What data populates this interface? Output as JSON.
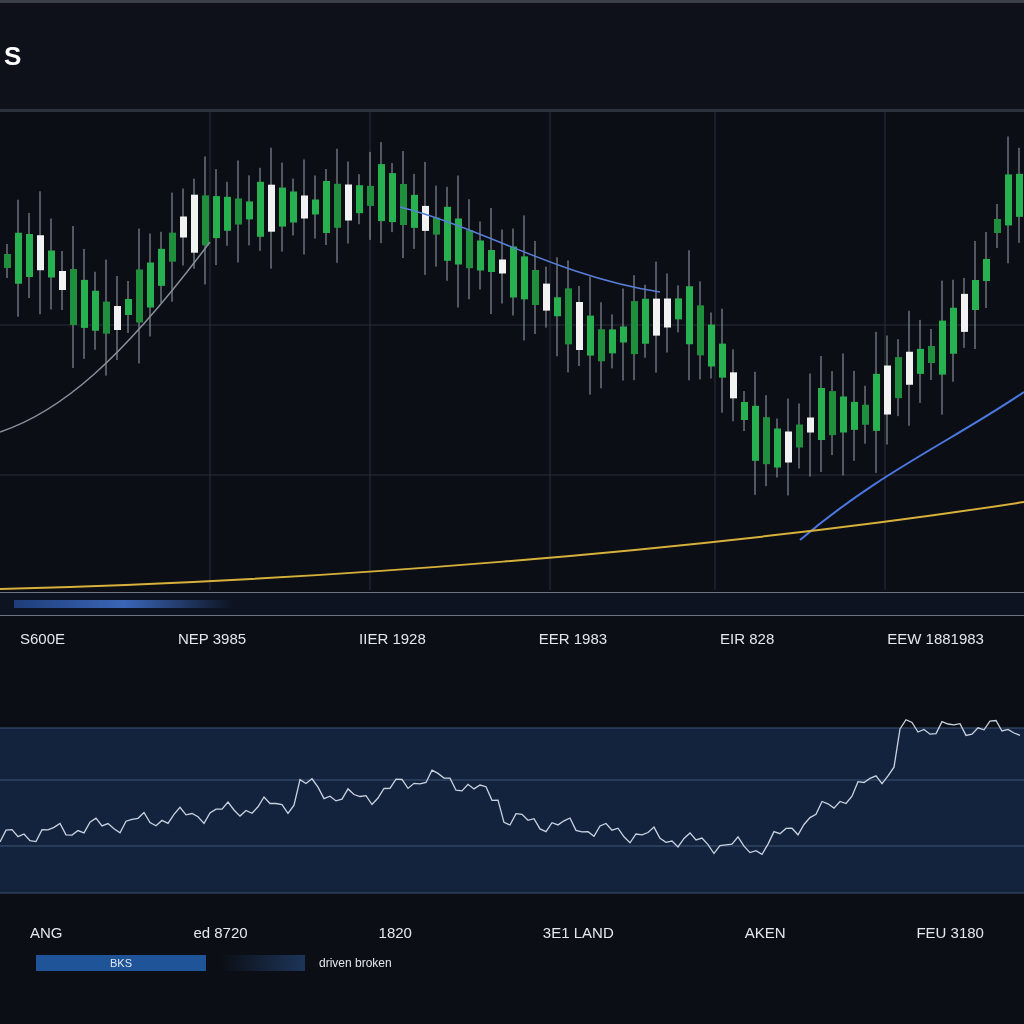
{
  "header": {
    "title": "S"
  },
  "main_chart": {
    "x_labels": [
      "S600E",
      "NEP 3985",
      "IIER 1928",
      "EER 1983",
      "EIR 828",
      "EEW 1881983"
    ]
  },
  "indicator_chart": {
    "x_labels": [
      "ANG",
      "ed 8720",
      "1820",
      "3E1 LAND",
      "AKEN",
      "FEU 3180"
    ]
  },
  "legend": [
    {
      "label": "BKS",
      "kind": "filled"
    },
    {
      "label": "driven broken",
      "kind": "line"
    }
  ]
}
